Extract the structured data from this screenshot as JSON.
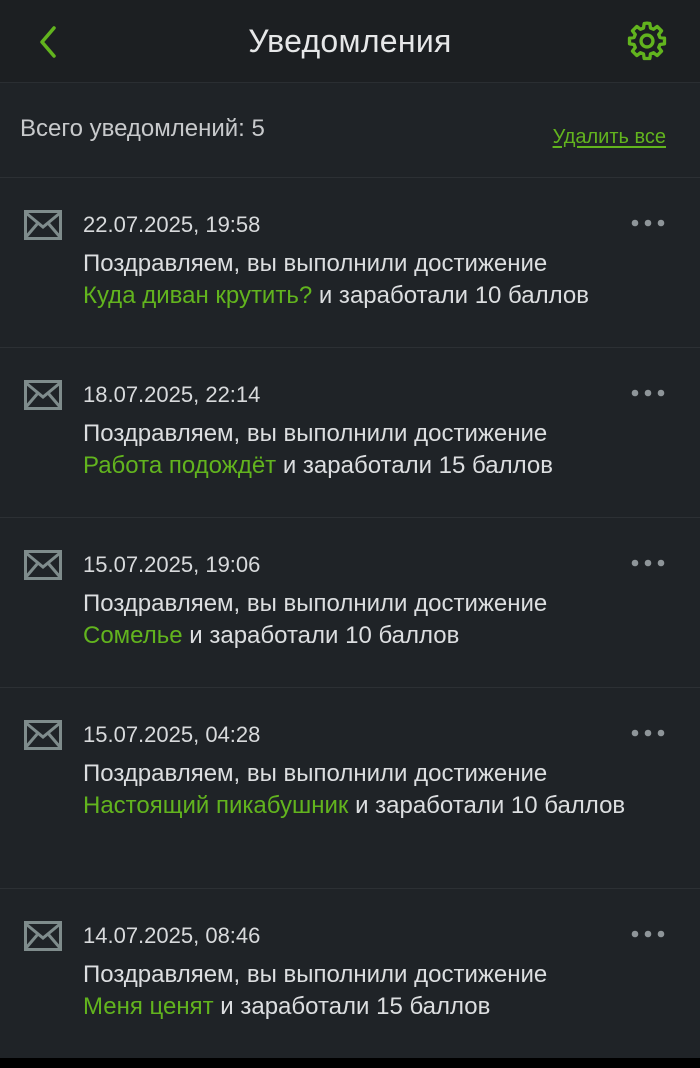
{
  "header": {
    "title": "Уведомления",
    "back_icon": "chevron-left-icon",
    "settings_icon": "gear-icon"
  },
  "summary": {
    "count_label": "Всего уведомлений: 5",
    "delete_all": "Удалить все"
  },
  "colors": {
    "accent": "#62b41e",
    "background": "#1f2327",
    "header_bg": "#1c1f22",
    "icon_gray": "#7f8c8c"
  },
  "notifications": [
    {
      "date": "22.07.2025, 19:58",
      "prefix": "Поздравляем, вы выполнили достижение",
      "achievement": "Куда диван крутить?",
      "suffix": "и заработали 10 баллов"
    },
    {
      "date": "18.07.2025, 22:14",
      "prefix": "Поздравляем, вы выполнили достижение",
      "achievement": "Работа подождёт",
      "suffix": "и заработали 15 баллов"
    },
    {
      "date": "15.07.2025, 19:06",
      "prefix": "Поздравляем, вы выполнили достижение",
      "achievement": "Сомелье",
      "suffix": "и заработали 10 баллов"
    },
    {
      "date": "15.07.2025, 04:28",
      "prefix": "Поздравляем, вы выполнили достижение",
      "achievement": "Настоящий пикабушник",
      "suffix": "и заработали 10 баллов"
    },
    {
      "date": "14.07.2025, 08:46",
      "prefix": "Поздравляем, вы выполнили достижение",
      "achievement": "Меня ценят",
      "suffix": "и заработали 15 баллов"
    }
  ]
}
